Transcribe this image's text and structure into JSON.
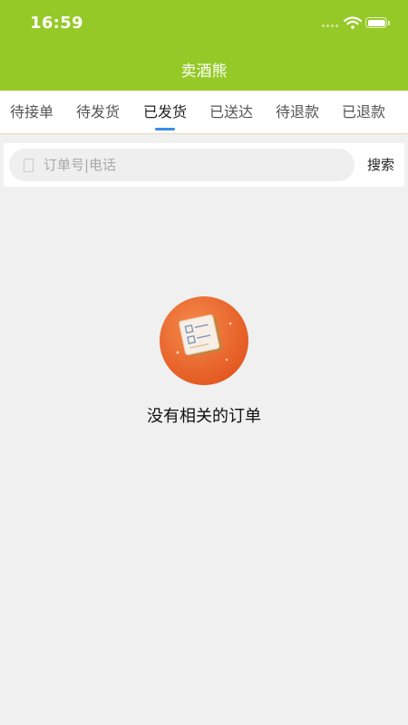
{
  "status_bar": {
    "time": "16:59"
  },
  "header": {
    "title": "卖酒熊",
    "background_color": "#95c927"
  },
  "tabs": [
    {
      "label": "待接单",
      "active": false
    },
    {
      "label": "待发货",
      "active": false
    },
    {
      "label": "已发货",
      "active": true
    },
    {
      "label": "已送达",
      "active": false
    },
    {
      "label": "待退款",
      "active": false
    },
    {
      "label": "已退款",
      "active": false
    }
  ],
  "search": {
    "placeholder": "订单号|电话",
    "value": "",
    "button_label": "搜索"
  },
  "empty_state": {
    "icon": "order-document-icon",
    "message": "没有相关的订单",
    "icon_color": "#ef6a2e"
  },
  "colors": {
    "accent": "#3a8ee6",
    "page_background": "#f0f0f0"
  }
}
